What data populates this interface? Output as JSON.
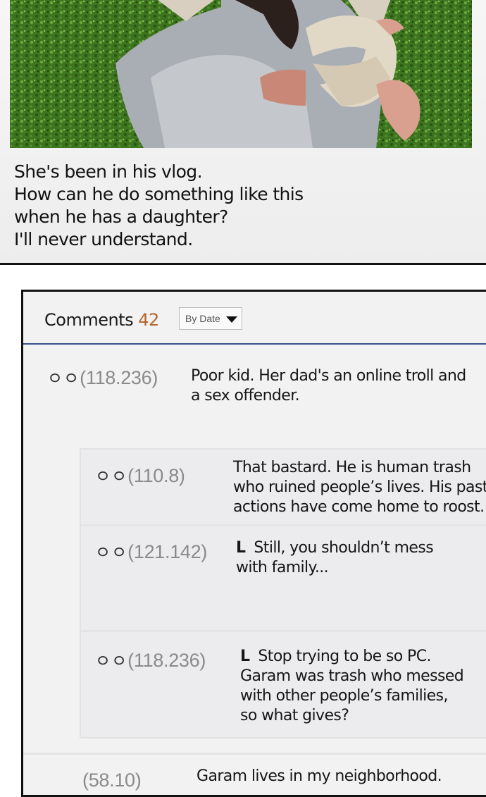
{
  "caption": {
    "lines": [
      "She's been in his vlog.",
      "How can he do something like this",
      "when he has a daughter?",
      "I'll never understand."
    ]
  },
  "comments_header": {
    "label": "Comments",
    "count": "42",
    "sort_label": "By Date"
  },
  "comments": [
    {
      "user": "(118.236)",
      "prefix": "ㅇㅇ",
      "lines": [
        "Poor kid. Her dad's an online troll and",
        "a sex offender."
      ]
    },
    {
      "user": "(110.8)",
      "prefix": "ㅇㅇ",
      "lines": [
        "That bastard. He is human trash",
        "who ruined people’s lives. His past",
        "actions have come home to roost."
      ]
    },
    {
      "user": "(121.142)",
      "prefix": "ㅇㅇ",
      "reply_marker": "L",
      "lines": [
        "Still, you shouldn’t mess",
        "with family..."
      ]
    },
    {
      "user": "(118.236)",
      "prefix": "ㅇㅇ",
      "reply_marker": "L",
      "lines": [
        "Stop trying to be so PC.",
        "Garam was trash who messed",
        "with other people’s families,",
        "so what gives?"
      ]
    },
    {
      "user": "(58.10)",
      "lines": [
        "Garam lives in my neighborhood."
      ]
    }
  ]
}
